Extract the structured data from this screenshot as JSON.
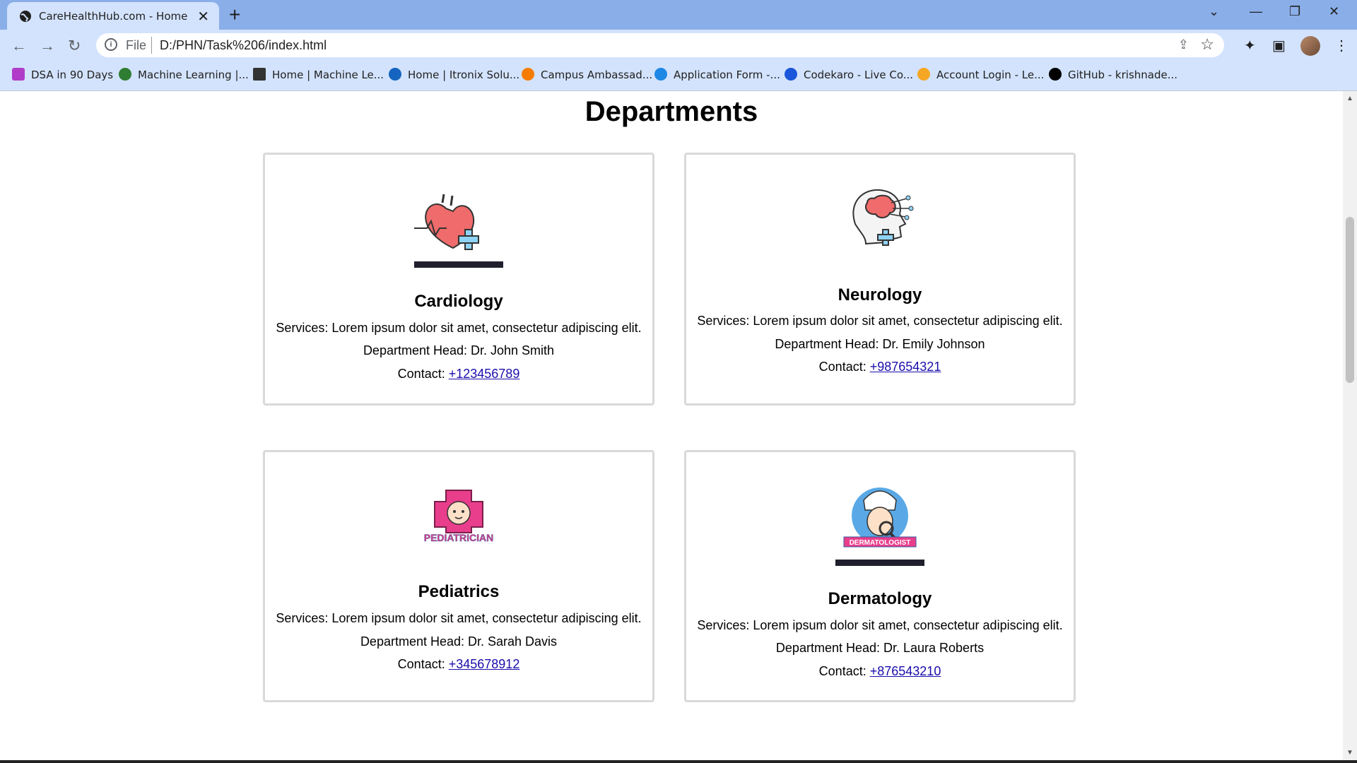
{
  "browser": {
    "tab_title": "CareHealthHub.com - Home",
    "url_scheme": "File",
    "url": "D:/PHN/Task%206/index.html",
    "bookmarks": [
      {
        "label": "DSA in 90 Days",
        "color": "#b03cc8"
      },
      {
        "label": "Machine Learning  |...",
        "color": "#2e7d32"
      },
      {
        "label": "Home | Machine Le...",
        "color": "#333333"
      },
      {
        "label": "Home | Itronix Solu...",
        "color": "#1565c0"
      },
      {
        "label": "Campus Ambassad...",
        "color": "#f57c00"
      },
      {
        "label": "Application Form -...",
        "color": "#1e88e5"
      },
      {
        "label": "Codekaro - Live Co...",
        "color": "#1a56db"
      },
      {
        "label": "Account Login - Le...",
        "color": "#f5a623"
      },
      {
        "label": "GitHub - krishnade...",
        "color": "#000000"
      }
    ]
  },
  "page": {
    "heading": "Departments",
    "departments": [
      {
        "name": "Cardiology",
        "services": "Services: Lorem ipsum dolor sit amet, consectetur adipiscing elit.",
        "head": "Department Head: Dr. John Smith",
        "contact_label": "Contact: ",
        "phone": "+123456789",
        "icon": "heart-icon"
      },
      {
        "name": "Neurology",
        "services": "Services: Lorem ipsum dolor sit amet, consectetur adipiscing elit.",
        "head": "Department Head: Dr. Emily Johnson",
        "contact_label": "Contact: ",
        "phone": "+987654321",
        "icon": "brain-icon"
      },
      {
        "name": "Pediatrics",
        "services": "Services: Lorem ipsum dolor sit amet, consectetur adipiscing elit.",
        "head": "Department Head: Dr. Sarah Davis",
        "contact_label": "Contact: ",
        "phone": "+345678912",
        "icon": "pediatrician-icon",
        "logo_text": "PEDIATRICIAN"
      },
      {
        "name": "Dermatology",
        "services": "Services: Lorem ipsum dolor sit amet, consectetur adipiscing elit.",
        "head": "Department Head: Dr. Laura Roberts",
        "contact_label": "Contact: ",
        "phone": "+876543210",
        "icon": "dermatology-icon",
        "logo_text": "DERMATOLOGIST"
      }
    ]
  }
}
